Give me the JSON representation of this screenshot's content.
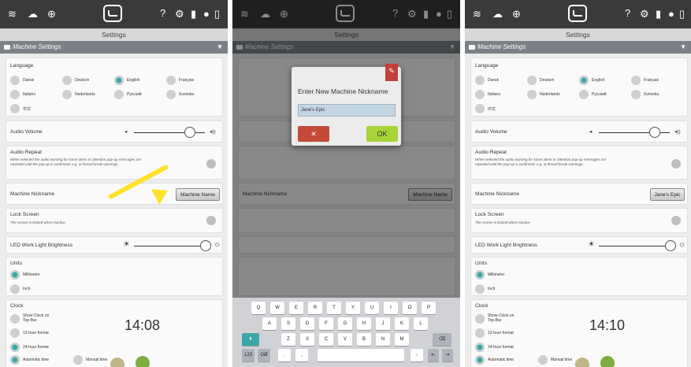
{
  "screen_title": "Settings",
  "section_title": "Machine Settings",
  "language_label": "Language",
  "languages": [
    "Dansk",
    "Deutsch",
    "English",
    "Français",
    "Italiano",
    "Nederlands",
    "Русский",
    "Svenska",
    "中文"
  ],
  "audio_volume_label": "Audio Volume",
  "audio_repeat_label": "Audio Repeat",
  "audio_repeat_desc": "When selected the audio warning for some alerts or attention pop-up messages are repeated until the pop-up is confirmed, e.g. at thread break warnings.",
  "machine_nickname_label": "Machine Nickname",
  "machine_nickname_button_before": "Machine Name",
  "machine_nickname_button_after": "Jane's Epic",
  "lock_screen_label": "Lock Screen",
  "lock_screen_desc": "The screen is locked when inactive.",
  "led_label": "LED Work Light Brightness",
  "units_label": "Units",
  "units": [
    "Millimeter",
    "Inch"
  ],
  "clock_label": "Clock",
  "clock_options": [
    "Show Clock on Top-Bar",
    "12-hour format",
    "24-hour format",
    "Automatic time",
    "Manual time"
  ],
  "clock_time_before": "14:08",
  "clock_time_after": "14:10",
  "dialog_title": "Enter New Machine Nickname",
  "dialog_input_value": "Jane's Epic",
  "dialog_cancel": "✕",
  "dialog_ok": "OK",
  "keyboard_row1": [
    "Q",
    "W",
    "E",
    "R",
    "T",
    "Y",
    "U",
    "I",
    "O",
    "P"
  ],
  "keyboard_row2": [
    "A",
    "S",
    "D",
    "F",
    "G",
    "H",
    "J",
    "K",
    "L"
  ],
  "keyboard_row3": [
    "Z",
    "X",
    "C",
    "V",
    "B",
    "N",
    "M"
  ],
  "keyboard_row4": [
    "123",
    "OØ",
    ".",
    ","
  ],
  "colors": {
    "accent": "#3aa8a8",
    "topbar": "#3a3a3a",
    "section": "#7b8186",
    "arrow": "#ffe12a",
    "ok": "#a7d438",
    "cancel": "#c44a3a"
  }
}
